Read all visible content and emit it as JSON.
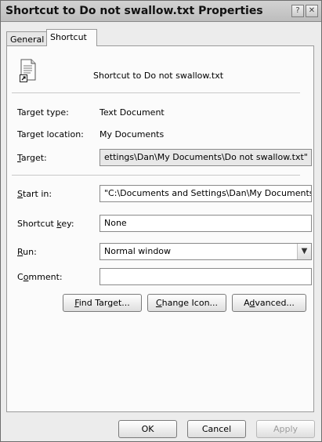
{
  "window": {
    "title": "Shortcut to Do not swallow.txt Properties",
    "help_glyph": "?",
    "close_glyph": "✕"
  },
  "tabs": [
    {
      "label": "General"
    },
    {
      "label": "Shortcut",
      "active": true
    }
  ],
  "header": {
    "name": "Shortcut to Do not swallow.txt",
    "icon": "text-file-shortcut-icon"
  },
  "info": {
    "target_type_label": "Target type:",
    "target_type_value": "Text Document",
    "target_location_label": "Target location:",
    "target_location_value": "My Documents"
  },
  "fields": {
    "target": {
      "label_hot": "T",
      "label_rest": "arget:",
      "value": "ettings\\Dan\\My Documents\\Do not swallow.txt\""
    },
    "start_in": {
      "label_hot": "S",
      "label_rest": "tart in:",
      "value": "\"C:\\Documents and Settings\\Dan\\My Documents"
    },
    "shortcut_key": {
      "label_pre": "Shortcut ",
      "label_hot": "k",
      "label_rest": "ey:",
      "value": "None"
    },
    "run": {
      "label_hot": "R",
      "label_rest": "un:",
      "value": "Normal window"
    },
    "comment": {
      "label_pre": "C",
      "label_hot": "o",
      "label_rest": "mment:",
      "value": ""
    }
  },
  "actions": {
    "find_target": {
      "hot": "F",
      "rest": "ind Target..."
    },
    "change_icon": {
      "hot": "C",
      "rest": "hange Icon..."
    },
    "advanced": {
      "pre": "A",
      "hot": "d",
      "rest": "vanced..."
    }
  },
  "footer": {
    "ok": "OK",
    "cancel": "Cancel",
    "apply": "Apply"
  }
}
